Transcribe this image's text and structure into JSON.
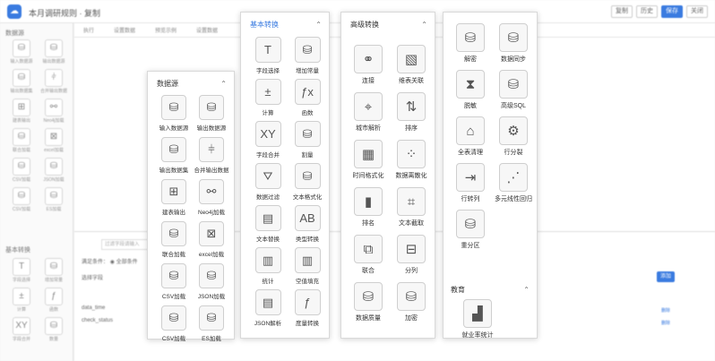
{
  "app": {
    "title": "本月调研规则 · 复制",
    "top_buttons": [
      "复制",
      "历史",
      "保存",
      "关闭"
    ]
  },
  "left_panel": {
    "section1": "数据源",
    "items1": [
      {
        "label": "输入数据源",
        "icon": "⛁"
      },
      {
        "label": "输出数据源",
        "icon": "⛁"
      },
      {
        "label": "输出数据集",
        "icon": "⛁"
      },
      {
        "label": "合并输出数据",
        "icon": "⫩"
      },
      {
        "label": "建表输出",
        "icon": "⊞"
      },
      {
        "label": "Neo4j加载",
        "icon": "⚯"
      },
      {
        "label": "联合加载",
        "icon": "⛁"
      },
      {
        "label": "excel加载",
        "icon": "⊠"
      },
      {
        "label": "CSV加载",
        "icon": "⛁"
      },
      {
        "label": "JSON加载",
        "icon": "⛁"
      },
      {
        "label": "CSV加载",
        "icon": "⛁"
      },
      {
        "label": "ES加载",
        "icon": "⛁"
      }
    ],
    "section2": "基本转换",
    "items2": [
      {
        "label": "字段选择",
        "icon": "T"
      },
      {
        "label": "增加常量",
        "icon": "⛁"
      },
      {
        "label": "计算",
        "icon": "±"
      },
      {
        "label": "函数",
        "icon": "ƒ"
      },
      {
        "label": "字段合并",
        "icon": "XY"
      },
      {
        "label": "数量",
        "icon": "⛁"
      }
    ]
  },
  "toolbar": {
    "items": [
      "执行",
      "设置数据",
      "预览示例",
      "设置数据"
    ]
  },
  "bottom": {
    "search_placeholder": "过滤字段请输入",
    "radio_label": "满足条件：  ◉ 全部条件",
    "header": "选择字段",
    "add_button": "添加",
    "rows": [
      "data_time",
      "check_status"
    ],
    "link": "删除"
  },
  "panel_datasource": {
    "title": "数据源",
    "items": [
      {
        "label": "输入数据源",
        "icon": "⛁"
      },
      {
        "label": "输出数据源",
        "icon": "⛁"
      },
      {
        "label": "输出数据集",
        "icon": "⛁"
      },
      {
        "label": "合并输出数据",
        "icon": "⫩"
      },
      {
        "label": "建表输出",
        "icon": "⊞"
      },
      {
        "label": "Neo4j加载",
        "icon": "⚯"
      },
      {
        "label": "联合加载",
        "icon": "⛁"
      },
      {
        "label": "excel加载",
        "icon": "⊠"
      },
      {
        "label": "CSV加载",
        "icon": "⛁"
      },
      {
        "label": "JSON加载",
        "icon": "⛁"
      },
      {
        "label": "CSV加载",
        "icon": "⛁"
      },
      {
        "label": "ES加载",
        "icon": "⛁"
      }
    ]
  },
  "panel_basic": {
    "title": "基本转换",
    "items": [
      {
        "label": "字段选择",
        "icon": "T"
      },
      {
        "label": "增加常量",
        "icon": "⛁"
      },
      {
        "label": "计算",
        "icon": "±"
      },
      {
        "label": "函数",
        "icon": "ƒx"
      },
      {
        "label": "字段合并",
        "icon": "XY"
      },
      {
        "label": "割量",
        "icon": "⛁"
      },
      {
        "label": "数据过滤",
        "icon": "⛛"
      },
      {
        "label": "文本格式化",
        "icon": "⛁"
      },
      {
        "label": "文本替换",
        "icon": "▤"
      },
      {
        "label": "类型转换",
        "icon": "AB"
      },
      {
        "label": "统计",
        "icon": "▥"
      },
      {
        "label": "空值填充",
        "icon": "▥"
      },
      {
        "label": "JSON解析",
        "icon": "▤"
      },
      {
        "label": "度量转换",
        "icon": "ƒ"
      }
    ]
  },
  "panel_advanced": {
    "title": "高级转换",
    "items": [
      {
        "label": "连接",
        "icon": "⚭"
      },
      {
        "label": "维表关联",
        "icon": "▧"
      },
      {
        "label": "城市解析",
        "icon": "⌖"
      },
      {
        "label": "排序",
        "icon": "⇅"
      },
      {
        "label": "时间格式化",
        "icon": "▦"
      },
      {
        "label": "数据离散化",
        "icon": "⁘"
      },
      {
        "label": "排名",
        "icon": "▮"
      },
      {
        "label": "文本截取",
        "icon": "⌗"
      },
      {
        "label": "联合",
        "icon": "⧉"
      },
      {
        "label": "分列",
        "icon": "⊟"
      },
      {
        "label": "数据质量",
        "icon": "⛁"
      },
      {
        "label": "加密",
        "icon": "⛁"
      }
    ]
  },
  "panel_advanced2": {
    "items": [
      {
        "label": "解密",
        "icon": "⛁"
      },
      {
        "label": "数据同步",
        "icon": "⛁"
      },
      {
        "label": "脱敏",
        "icon": "⧗"
      },
      {
        "label": "高级SQL",
        "icon": "⛁"
      },
      {
        "label": "全表清理",
        "icon": "⌂"
      },
      {
        "label": "行分裂",
        "icon": "⚙"
      },
      {
        "label": "行转列",
        "icon": "⇥"
      },
      {
        "label": "多元线性回归",
        "icon": "⋰"
      },
      {
        "label": "重分区",
        "icon": "⛁"
      }
    ],
    "section2_title": "教育",
    "section2_items": [
      {
        "label": "就业率统计",
        "icon": "▟"
      }
    ]
  }
}
